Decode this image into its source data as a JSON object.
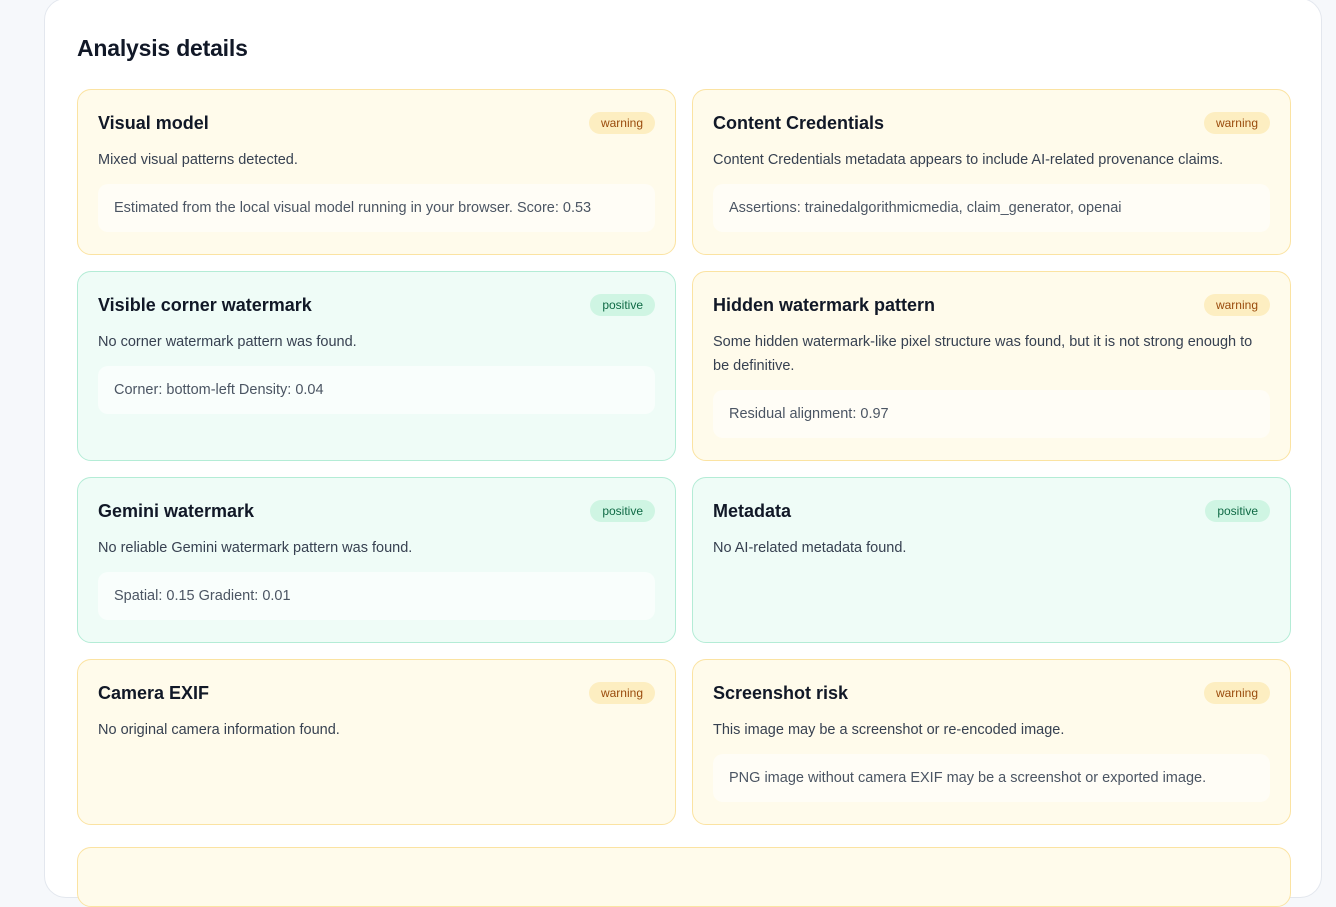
{
  "panel": {
    "title": "Analysis details"
  },
  "cards": [
    {
      "title": "Visual model",
      "status": "warning",
      "description": "Mixed visual patterns detected.",
      "detail": "Estimated from the local visual model running in your browser. Score: 0.53"
    },
    {
      "title": "Content Credentials",
      "status": "warning",
      "description": "Content Credentials metadata appears to include AI-related provenance claims.",
      "detail": "Assertions: trainedalgorithmicmedia, claim_generator, openai"
    },
    {
      "title": "Visible corner watermark",
      "status": "positive",
      "description": "No corner watermark pattern was found.",
      "detail": "Corner: bottom-left Density: 0.04"
    },
    {
      "title": "Hidden watermark pattern",
      "status": "warning",
      "description": "Some hidden watermark-like pixel structure was found, but it is not strong enough to be definitive.",
      "detail": "Residual alignment: 0.97"
    },
    {
      "title": "Gemini watermark",
      "status": "positive",
      "description": "No reliable Gemini watermark pattern was found.",
      "detail": "Spatial: 0.15 Gradient: 0.01"
    },
    {
      "title": "Metadata",
      "status": "positive",
      "description": "No AI-related metadata found.",
      "detail": ""
    },
    {
      "title": "Camera EXIF",
      "status": "warning",
      "description": "No original camera information found.",
      "detail": ""
    },
    {
      "title": "Screenshot risk",
      "status": "warning",
      "description": "This image may be a screenshot or re-encoded image.",
      "detail": "PNG image without camera EXIF may be a screenshot or exported image."
    }
  ],
  "colors": {
    "warning_bg": "#fffbeb",
    "warning_border": "#fbe3a2",
    "warning_badge_text": "#9a4b0c",
    "positive_bg": "#effcf7",
    "positive_border": "#b4ecd6",
    "positive_badge_text": "#0f6a45"
  }
}
